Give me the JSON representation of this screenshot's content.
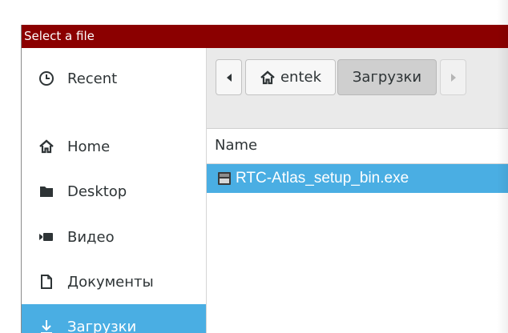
{
  "window": {
    "title": "Select a file"
  },
  "sidebar": {
    "items": [
      {
        "label": "Recent",
        "icon": "clock-icon"
      },
      {
        "label": "Home",
        "icon": "home-icon"
      },
      {
        "label": "Desktop",
        "icon": "folder-icon"
      },
      {
        "label": "Видео",
        "icon": "video-icon"
      },
      {
        "label": "Документы",
        "icon": "document-icon"
      },
      {
        "label": "Загрузки",
        "icon": "download-icon",
        "selected": true
      }
    ]
  },
  "pathbar": {
    "back_icon": "chevron-left-icon",
    "home_label": "entek",
    "current_label": "Загрузки",
    "forward_icon": "chevron-right-icon"
  },
  "file_list": {
    "column_header": "Name",
    "files": [
      {
        "name": "RTC-Atlas_setup_bin.exe",
        "icon": "executable-icon",
        "selected": true
      }
    ]
  },
  "colors": {
    "titlebar": "#8b0000",
    "selection": "#4aaee3"
  }
}
